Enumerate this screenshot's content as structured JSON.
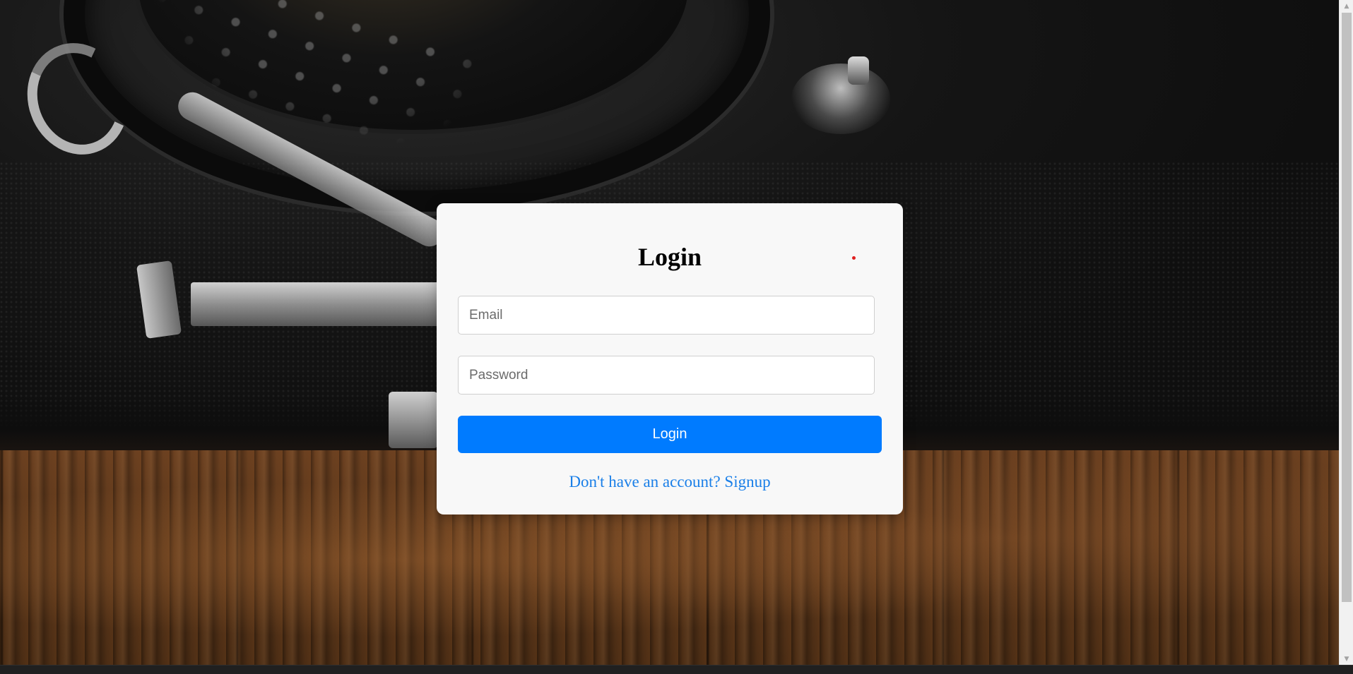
{
  "login_card": {
    "title": "Login",
    "email_placeholder": "Email",
    "password_placeholder": "Password",
    "submit_label": "Login",
    "signup_link_text": "Don't have an account? Signup"
  },
  "colors": {
    "card_background": "#f8f8f8",
    "button_primary": "#007bff",
    "link": "#1a7fe8",
    "indicator_dot": "#e02020"
  },
  "icons": {
    "scroll_up": "scroll-up-arrow-icon",
    "scroll_down": "scroll-down-arrow-icon"
  }
}
